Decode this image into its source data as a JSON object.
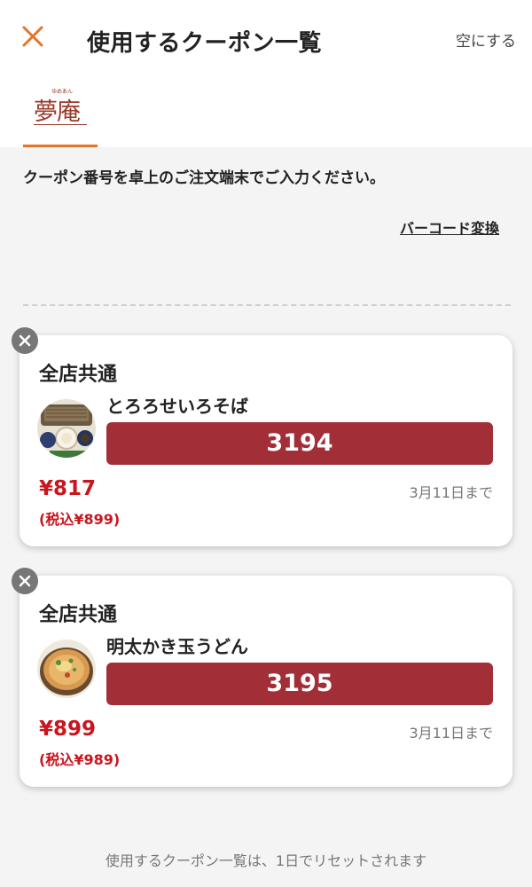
{
  "header": {
    "title": "使用するクーポン一覧",
    "clear_label": "空にする",
    "close_icon": "close-icon",
    "accent_color": "#e67326"
  },
  "tabs": [
    {
      "logo_text": "夢庵",
      "logo_sub": "ゆめあん",
      "active": true
    }
  ],
  "instruction": "クーポン番号を卓上のご注文端末でご入力ください。",
  "barcode_link": "バーコード変換",
  "coupons": [
    {
      "store": "全店共通",
      "item": "とろろせいろそば",
      "code": "3194",
      "price": "¥817",
      "price_tax": "(税込¥899)",
      "expiry": "3月11日まで",
      "thumb_icon": "soba-dish-image"
    },
    {
      "store": "全店共通",
      "item": "明太かき玉うどん",
      "code": "3195",
      "price": "¥899",
      "price_tax": "(税込¥989)",
      "expiry": "3月11日まで",
      "thumb_icon": "udon-bowl-image"
    }
  ],
  "footer_note": "使用するクーポン一覧は、1日でリセットされます",
  "colors": {
    "code_bg": "#a22e37",
    "price": "#c9151e",
    "logo": "#9a3a28"
  }
}
